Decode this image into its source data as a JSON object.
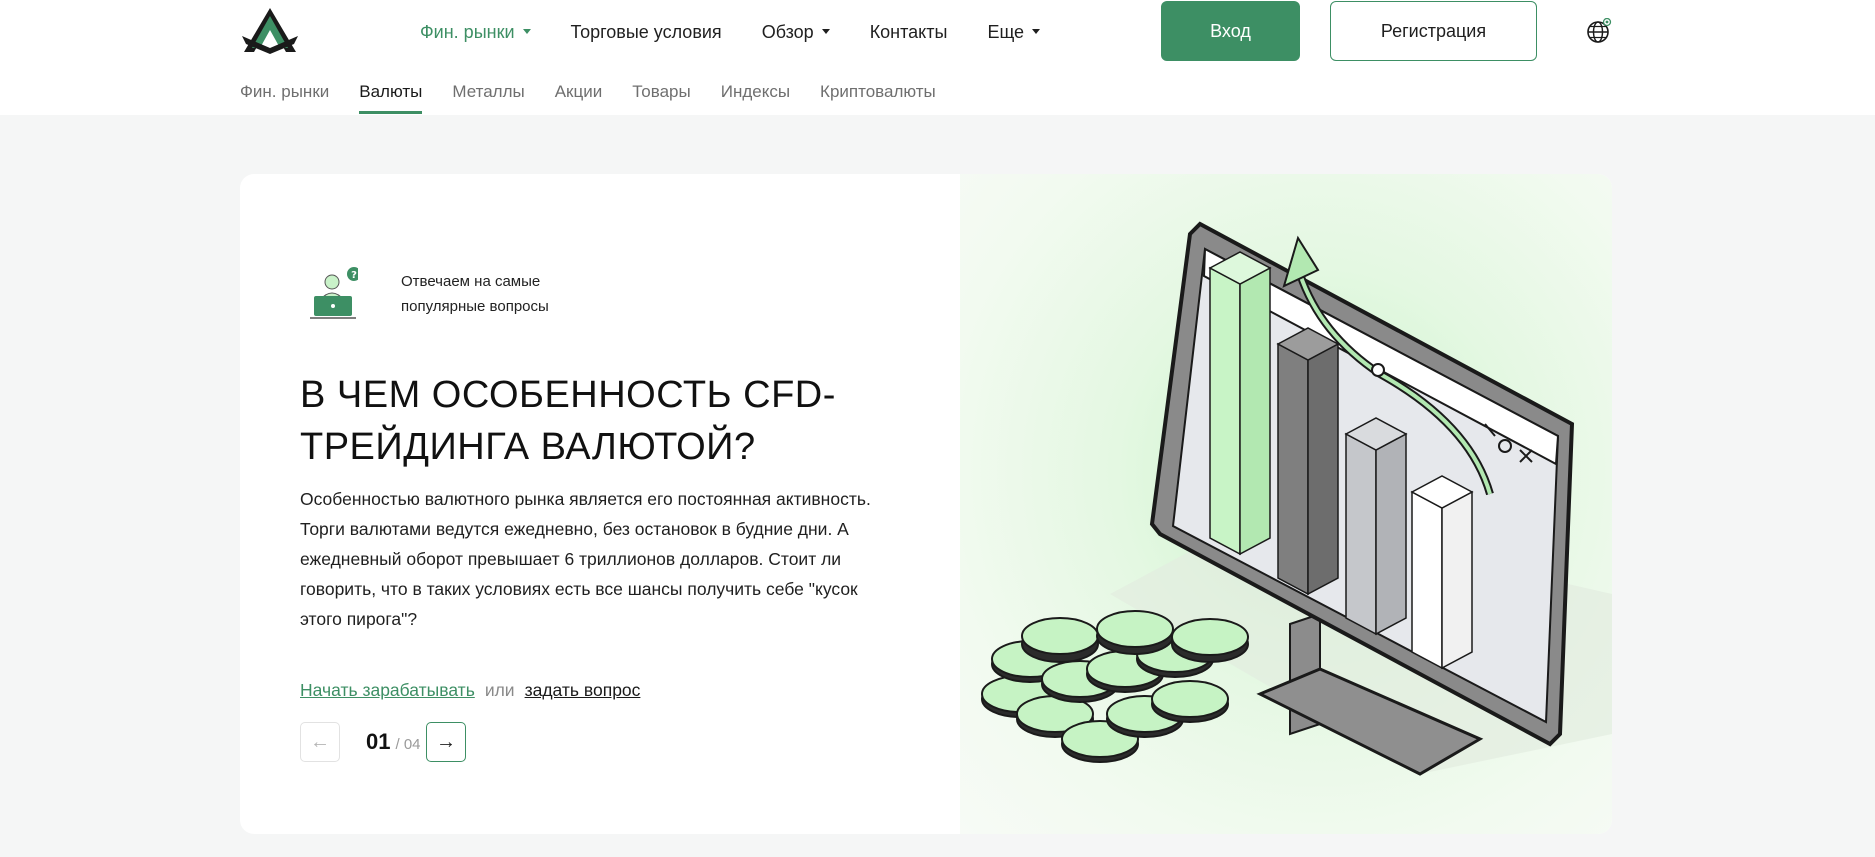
{
  "colors": {
    "accent": "#3d8f64",
    "light_green": "#c9f2c9",
    "page_bg": "#f5f6f6"
  },
  "header": {
    "logo_icon": "brand-logo-icon",
    "nav": [
      {
        "label": "Фин. рынки",
        "has_dropdown": true,
        "active": true
      },
      {
        "label": "Торговые условия",
        "has_dropdown": false
      },
      {
        "label": "Обзор",
        "has_dropdown": true
      },
      {
        "label": "Контакты",
        "has_dropdown": false
      },
      {
        "label": "Еще",
        "has_dropdown": true
      }
    ],
    "login_label": "Вход",
    "register_label": "Регистрация",
    "language_icon": "globe-icon"
  },
  "subnav": [
    {
      "label": "Фин. рынки"
    },
    {
      "label": "Валюты",
      "active": true
    },
    {
      "label": "Металлы"
    },
    {
      "label": "Акции"
    },
    {
      "label": "Товары"
    },
    {
      "label": "Индексы"
    },
    {
      "label": "Криптовалюты"
    }
  ],
  "hero": {
    "faq_icon": "support-person-laptop-icon",
    "faq_text": "Отвечаем на самые популярные вопросы",
    "title": "В ЧЕМ ОСОБЕННОСТЬ CFD-ТРЕЙДИНГА ВАЛЮТОЙ?",
    "description": "Особенностью валютного рынка является его постоянная активность. Торги валютами ведутся ежедневно, без остановок в будние дни. А ежедневный оборот превышает 6 триллионов долларов. Стоит ли говорить, что в таких условиях есть все шансы получить себе \"кусок этого пирога\"?",
    "cta_primary": "Начать зарабатывать",
    "cta_or": "или",
    "cta_secondary": "задать вопрос",
    "pager": {
      "current": "01",
      "total": "/ 04",
      "prev_icon": "←",
      "next_icon": "→"
    },
    "illustration": "monitor-bar-chart-coins-illustration"
  }
}
